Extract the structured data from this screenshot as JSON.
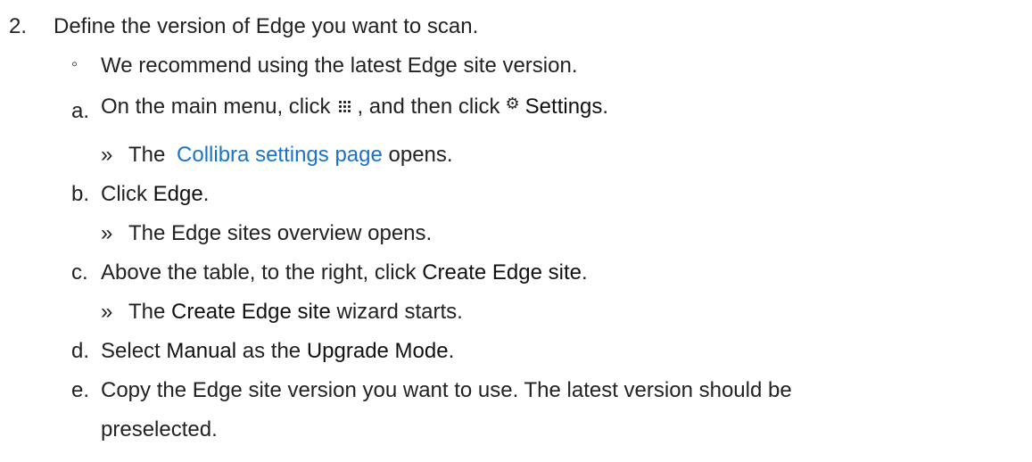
{
  "step": {
    "number": "2.",
    "text": "Define the version of Edge you want to scan."
  },
  "note": {
    "bullet": "◦",
    "text": "We recommend using the latest Edge site version."
  },
  "substeps": {
    "a": {
      "marker": "a.",
      "prefix": "On the main menu, click",
      "icon": "grid-menu-icon",
      "middle": ", and then click",
      "icon2": "gear-icon",
      "bold": "Settings",
      "suffix": ".",
      "result_marker": "»",
      "result_prefix": "The",
      "result_link": "Collibra settings page",
      "result_suffix": "opens."
    },
    "b": {
      "marker": "b.",
      "prefix": "Click",
      "bold": "Edge",
      "suffix": ".",
      "result_marker": "»",
      "result_text": "The Edge sites overview opens."
    },
    "c": {
      "marker": "c.",
      "prefix": "Above the table, to the right, click",
      "bold": "Create Edge site",
      "suffix": ".",
      "result_marker": "»",
      "result_prefix": "The",
      "result_bold": "Create Edge site",
      "result_suffix": "wizard starts."
    },
    "d": {
      "marker": "d.",
      "prefix": "Select",
      "bold1": "Manual",
      "middle": "as the",
      "bold2": "Upgrade Mode",
      "suffix": "."
    },
    "e": {
      "marker": "e.",
      "line1": "Copy the Edge site version you want to use. The latest version should be",
      "line2": "preselected."
    }
  },
  "colors": {
    "text": "#222222",
    "link": "#1a73c8"
  }
}
